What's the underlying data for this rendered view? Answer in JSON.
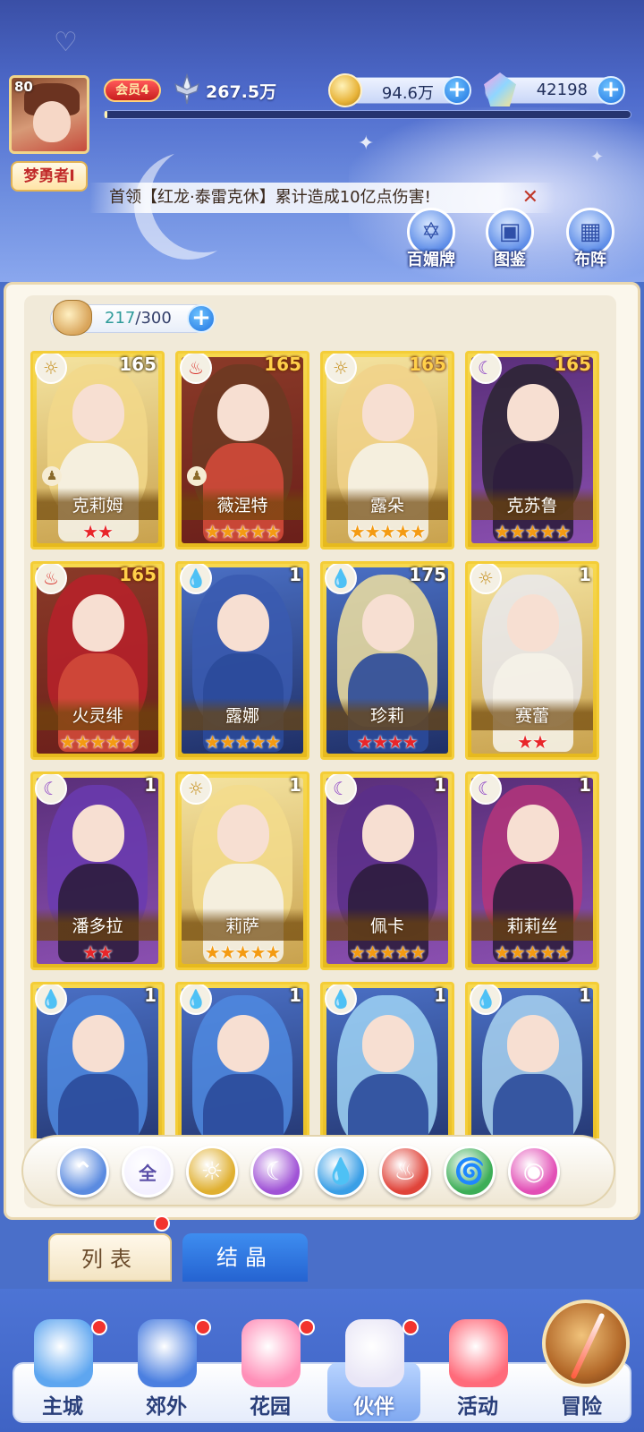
{
  "player": {
    "level": "80",
    "nickname": "梦勇者I",
    "vip": "会员4",
    "power": "267.5万",
    "exp_progress": 0.005
  },
  "currencies": {
    "gold": "94.6万",
    "diamond": "42198"
  },
  "marquee": "首领【红龙·泰雷克休】累计造成10亿点伤害!",
  "quick_buttons": [
    "百媚牌",
    "图鉴",
    "布阵"
  ],
  "capacity": {
    "current": "217",
    "separator": "/",
    "max": "300"
  },
  "heroes": [
    {
      "name": "克莉姆",
      "level": "165",
      "element": "light",
      "stars": 2,
      "star_color": "red",
      "level_color": "white",
      "pawn": true
    },
    {
      "name": "薇涅特",
      "level": "165",
      "element": "fire",
      "stars": 5,
      "star_color": "gold",
      "level_color": "gold",
      "pawn": true
    },
    {
      "name": "露朵",
      "level": "165",
      "element": "light",
      "stars": 5,
      "star_color": "gold",
      "level_color": "gold",
      "pawn": false
    },
    {
      "name": "克苏鲁",
      "level": "165",
      "element": "dark",
      "stars": 5,
      "star_color": "gold",
      "level_color": "gold",
      "pawn": false
    },
    {
      "name": "火灵绯",
      "level": "165",
      "element": "fire",
      "stars": 5,
      "star_color": "gold",
      "level_color": "gold",
      "pawn": false
    },
    {
      "name": "露娜",
      "level": "1",
      "element": "water",
      "stars": 5,
      "star_color": "gold",
      "level_color": "white",
      "pawn": false
    },
    {
      "name": "珍莉",
      "level": "175",
      "element": "water",
      "stars": 4,
      "star_color": "red",
      "level_color": "white",
      "pawn": false
    },
    {
      "name": "赛蕾",
      "level": "1",
      "element": "light",
      "stars": 2,
      "star_color": "red",
      "level_color": "white",
      "pawn": false
    },
    {
      "name": "潘多拉",
      "level": "1",
      "element": "dark",
      "stars": 2,
      "star_color": "red",
      "level_color": "white",
      "pawn": false
    },
    {
      "name": "莉萨",
      "level": "1",
      "element": "light",
      "stars": 5,
      "star_color": "gold",
      "level_color": "white",
      "pawn": false
    },
    {
      "name": "佩卡",
      "level": "1",
      "element": "dark",
      "stars": 5,
      "star_color": "gold",
      "level_color": "white",
      "pawn": false
    },
    {
      "name": "莉莉丝",
      "level": "1",
      "element": "dark",
      "stars": 5,
      "star_color": "gold",
      "level_color": "white",
      "pawn": false
    },
    {
      "name": "",
      "level": "1",
      "element": "water",
      "stars": 0,
      "star_color": "gold",
      "level_color": "white",
      "pawn": false
    },
    {
      "name": "",
      "level": "1",
      "element": "water",
      "stars": 0,
      "star_color": "gold",
      "level_color": "white",
      "pawn": false
    },
    {
      "name": "",
      "level": "1",
      "element": "water",
      "stars": 0,
      "star_color": "gold",
      "level_color": "white",
      "pawn": false
    },
    {
      "name": "",
      "level": "1",
      "element": "water",
      "stars": 0,
      "star_color": "gold",
      "level_color": "white",
      "pawn": false
    }
  ],
  "filters": [
    {
      "id": "sort",
      "label": "",
      "icon": "sort-arrow-icon",
      "color": "#5b8be0"
    },
    {
      "id": "all",
      "label": "全",
      "icon": "all-icon",
      "color": "#f3f0ff"
    },
    {
      "id": "light",
      "label": "",
      "icon": "light-element-icon",
      "color": "#e0b031"
    },
    {
      "id": "dark",
      "label": "",
      "icon": "dark-element-icon",
      "color": "#a053d6"
    },
    {
      "id": "water",
      "label": "",
      "icon": "water-element-icon",
      "color": "#3a9fe6"
    },
    {
      "id": "fire",
      "label": "",
      "icon": "fire-element-icon",
      "color": "#e0443a"
    },
    {
      "id": "wind",
      "label": "",
      "icon": "wind-element-icon",
      "color": "#3dae57"
    },
    {
      "id": "special",
      "label": "",
      "icon": "special-element-icon",
      "color": "#e24fb6"
    }
  ],
  "tabs": {
    "list": "列表",
    "crystal": "结晶"
  },
  "nav": [
    {
      "label": "主城",
      "icon": "castle-icon",
      "dot": true
    },
    {
      "label": "郊外",
      "icon": "portal-icon",
      "dot": true
    },
    {
      "label": "花园",
      "icon": "heart-icon",
      "dot": true
    },
    {
      "label": "伙伴",
      "icon": "partner-icon",
      "dot": true
    },
    {
      "label": "活动",
      "icon": "gift-icon",
      "dot": false
    },
    {
      "label": "冒险",
      "icon": "compass-icon",
      "dot": false
    }
  ],
  "element_colors": {
    "light": "#c9962a",
    "fire": "#d8352e",
    "water": "#2f86d6",
    "dark": "#8a3fc4"
  }
}
